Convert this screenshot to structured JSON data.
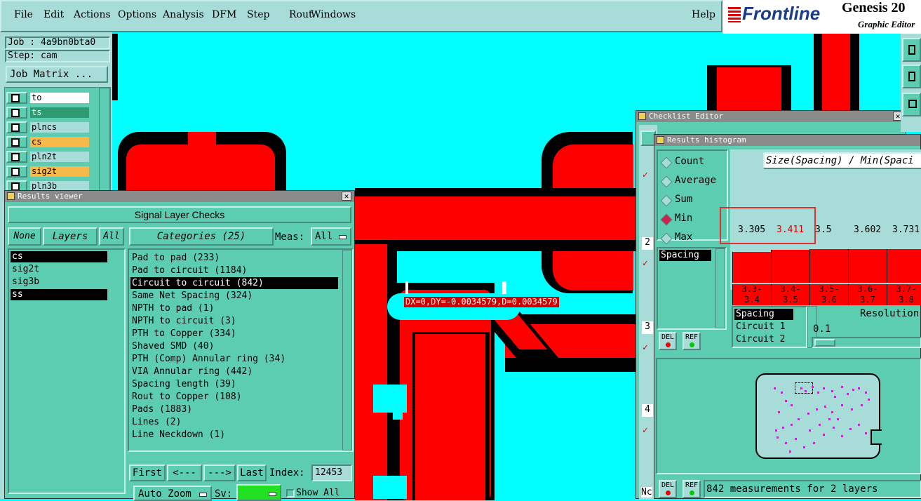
{
  "menu": {
    "items": [
      "File",
      "Edit",
      "Actions",
      "Options",
      "Analysis",
      "DFM",
      "Step",
      "Rout",
      "Windows"
    ],
    "help": "Help"
  },
  "brand": {
    "logo": "Frontline",
    "product": "Genesis 20",
    "subtitle": "Graphic Editor"
  },
  "job": {
    "job": "Job : 4a9bn0bta0",
    "step": "Step: cam",
    "matrix_button": "Job Matrix ..."
  },
  "layers": [
    {
      "name": "to",
      "state": "white"
    },
    {
      "name": "ts",
      "state": "green"
    },
    {
      "name": "plncs",
      "state": "light"
    },
    {
      "name": "cs",
      "state": "orange"
    },
    {
      "name": "pln2t",
      "state": "light"
    },
    {
      "name": "sig2t",
      "state": "orange"
    },
    {
      "name": "pln3b",
      "state": "light"
    }
  ],
  "results_viewer": {
    "title": "Results viewer",
    "header": "Signal Layer Checks",
    "none_btn": "None",
    "layers_btn": "Layers",
    "all_btn": "All",
    "categories_btn": "Categories (25)",
    "meas_label": "Meas:",
    "meas_value": "All",
    "layer_list": [
      "cs",
      "sig2t",
      "sig3b",
      "ss"
    ],
    "categories": [
      "Pad to pad (233)",
      "Pad to circuit (1184)",
      "Circuit to circuit (842)",
      "Same Net Spacing (324)",
      "NPTH to pad (1)",
      "NPTH to circuit (3)",
      "PTH to Copper (334)",
      "Shaved SMD (40)",
      "PTH (Comp) Annular ring (34)",
      "VIA Annular ring (442)",
      "Spacing length (39)",
      "Rout to Copper (108)",
      "Pads (1883)",
      "Lines (2)",
      "Line Neckdown (1)"
    ],
    "first_btn": "First",
    "prev_btn": "<---",
    "next_btn": "--->",
    "last_btn": "Last",
    "index_label": "Index:",
    "index_value": "12453",
    "autozoom": "Auto Zoom",
    "sv_label": "Sv:",
    "show_all": "Show All"
  },
  "measurement_label": "DX=0,DY=-0.0034579,D=0.0034579",
  "checklist": {
    "title": "Checklist Editor",
    "side_numbers": [
      "2",
      "3",
      "4"
    ],
    "no_label": "Nc"
  },
  "histogram": {
    "title": "Results histogram",
    "modes": [
      "Count",
      "Average",
      "Sum",
      "Min",
      "Max"
    ],
    "selected_mode": "Min",
    "heading": "Size(Spacing) / Min(Spaci",
    "spacing_item": "Spacing",
    "del_btn": "DEL",
    "ref_btn": "REF",
    "values": [
      "3.305",
      "3.411",
      "3.5",
      "3.602",
      "3.731"
    ],
    "ranges": [
      [
        "3.3-",
        "3.4"
      ],
      [
        "3.4-",
        "3.5"
      ],
      [
        "3.5-",
        "3.6"
      ],
      [
        "3.6-",
        "3.7"
      ],
      [
        "3.7-",
        "3.8"
      ]
    ],
    "list": [
      "Spacing",
      "Circuit 1",
      "Circuit 2"
    ],
    "resolution_label": "Resolution",
    "resolution_value": "0.1",
    "status": "842 measurements for 2 layers"
  },
  "colors": {
    "copper": "#ff0000",
    "background": "#00ffff",
    "panel": "#5ccdb0",
    "highlight": "#ff0000"
  }
}
